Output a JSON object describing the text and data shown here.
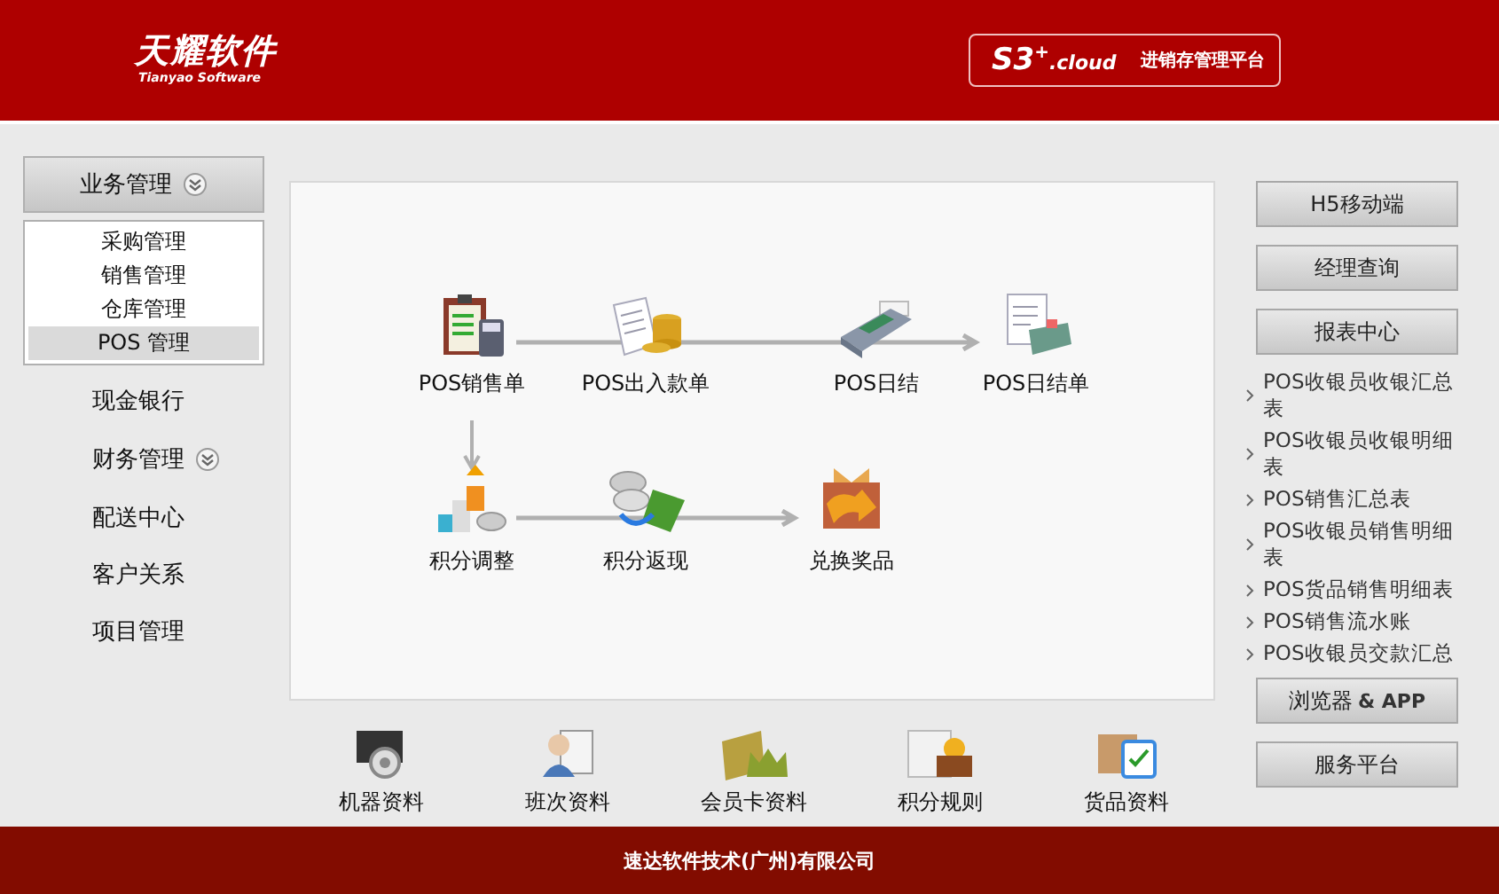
{
  "header": {
    "logo_cn": "天耀软件",
    "logo_en": "Tianyao Software",
    "product": "S3",
    "product_sup": "+",
    "product_suffix": ".cloud",
    "platform": "进销存管理平台"
  },
  "sidebar": {
    "items": [
      {
        "label": "业务管理",
        "expanded": true,
        "children": [
          {
            "label": "采购管理",
            "selected": false
          },
          {
            "label": "销售管理",
            "selected": false
          },
          {
            "label": "仓库管理",
            "selected": false
          },
          {
            "label": "POS 管理",
            "selected": true
          }
        ]
      },
      {
        "label": "现金银行"
      },
      {
        "label": "财务管理",
        "expanded": false
      },
      {
        "label": "配送中心"
      },
      {
        "label": "客户关系"
      },
      {
        "label": "项目管理"
      }
    ]
  },
  "flow": {
    "nodes": [
      {
        "label": "POS销售单",
        "kind": "clipboard"
      },
      {
        "label": "POS出入款单",
        "kind": "receipt"
      },
      {
        "label": "POS日结",
        "kind": "terminal"
      },
      {
        "label": "POS日结单",
        "kind": "report"
      },
      {
        "label": "积分调整",
        "kind": "stairs"
      },
      {
        "label": "积分返现",
        "kind": "cashback"
      },
      {
        "label": "兑换奖品",
        "kind": "gift"
      }
    ]
  },
  "shortcuts": [
    {
      "label": "机器资料",
      "kind": "machine"
    },
    {
      "label": "班次资料",
      "kind": "person"
    },
    {
      "label": "会员卡资料",
      "kind": "card"
    },
    {
      "label": "积分规则",
      "kind": "folder"
    },
    {
      "label": "货品资料",
      "kind": "box"
    }
  ],
  "right_panel": {
    "top_buttons": [
      "H5移动端",
      "经理查询",
      "报表中心"
    ],
    "reports": [
      "POS收银员收银汇总表",
      "POS收银员收银明细表",
      "POS销售汇总表",
      "POS收银员销售明细表",
      "POS货品销售明细表",
      "POS销售流水账",
      "POS收银员交款汇总"
    ],
    "bottom_buttons": [
      {
        "label": "浏览器",
        "suffix": "& APP"
      },
      {
        "label": "服务平台"
      }
    ]
  },
  "footer": {
    "text": "速达软件技术(广州)有限公司"
  }
}
